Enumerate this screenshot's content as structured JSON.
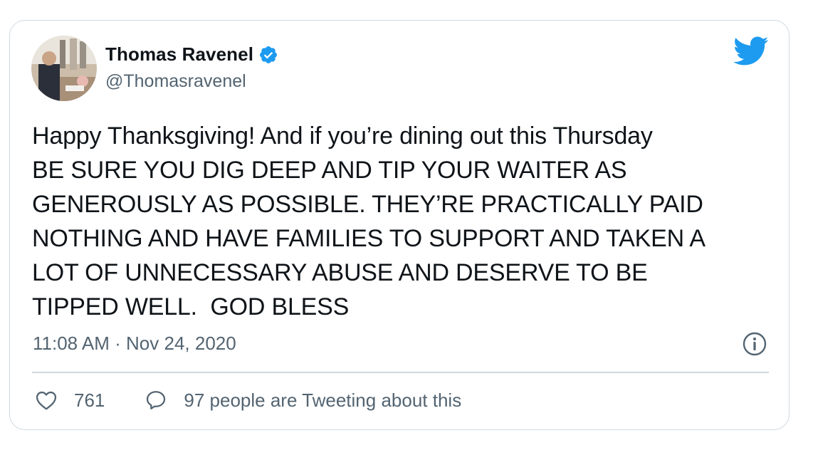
{
  "tweet": {
    "author_name": "Thomas Ravenel",
    "handle": "@Thomasravenel",
    "text": "Happy Thanksgiving! And if you’re dining out this Thursday\nBE SURE YOU DIG DEEP AND TIP YOUR WAITER AS\nGENEROUSLY AS POSSIBLE. THEY’RE PRACTICALLY PAID\nNOTHING AND HAVE FAMILIES TO SUPPORT AND TAKEN A\nLOT OF UNNECESSARY ABUSE AND DESERVE TO BE\nTIPPED WELL.  GOD BLESS",
    "timestamp": "11:08 AM · Nov 24, 2020",
    "like_count": "761",
    "conversation_label": "97 people are Tweeting about this"
  },
  "icons": {
    "verified": "verified-badge-icon",
    "brand": "twitter-bird-icon",
    "info": "info-icon",
    "like": "heart-icon",
    "reply": "speech-bubble-icon"
  },
  "colors": {
    "brand": "#1d9bf0",
    "text": "#0f1419",
    "muted": "#536471",
    "border": "#cfd9de"
  }
}
